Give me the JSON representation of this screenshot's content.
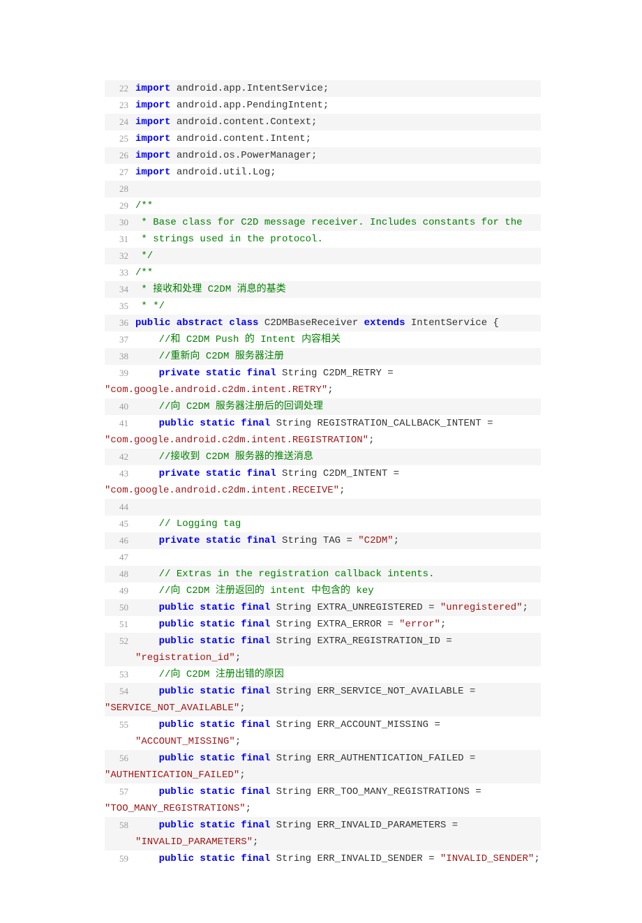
{
  "code_lines": [
    {
      "n": 22,
      "bg": true,
      "tokens": [
        {
          "t": "import",
          "c": "kw"
        },
        {
          "t": " android.app.IntentService;",
          "c": "plain"
        }
      ]
    },
    {
      "n": 23,
      "bg": false,
      "tokens": [
        {
          "t": "import",
          "c": "kw"
        },
        {
          "t": " android.app.PendingIntent;",
          "c": "plain"
        }
      ]
    },
    {
      "n": 24,
      "bg": true,
      "tokens": [
        {
          "t": "import",
          "c": "kw"
        },
        {
          "t": " android.content.Context;",
          "c": "plain"
        }
      ]
    },
    {
      "n": 25,
      "bg": false,
      "tokens": [
        {
          "t": "import",
          "c": "kw"
        },
        {
          "t": " android.content.Intent;",
          "c": "plain"
        }
      ]
    },
    {
      "n": 26,
      "bg": true,
      "tokens": [
        {
          "t": "import",
          "c": "kw"
        },
        {
          "t": " android.os.PowerManager;",
          "c": "plain"
        }
      ]
    },
    {
      "n": 27,
      "bg": false,
      "tokens": [
        {
          "t": "import",
          "c": "kw"
        },
        {
          "t": " android.util.Log;",
          "c": "plain"
        }
      ]
    },
    {
      "n": 28,
      "bg": true,
      "tokens": []
    },
    {
      "n": 29,
      "bg": false,
      "tokens": [
        {
          "t": "/**",
          "c": "cmt"
        }
      ]
    },
    {
      "n": 30,
      "bg": true,
      "tokens": [
        {
          "t": " * Base class for C2D message receiver. Includes constants for the",
          "c": "cmt"
        }
      ]
    },
    {
      "n": 31,
      "bg": false,
      "tokens": [
        {
          "t": " * strings used in the protocol.",
          "c": "cmt"
        }
      ]
    },
    {
      "n": 32,
      "bg": true,
      "tokens": [
        {
          "t": " */",
          "c": "cmt"
        }
      ]
    },
    {
      "n": 33,
      "bg": false,
      "tokens": [
        {
          "t": "/**",
          "c": "cmt"
        }
      ]
    },
    {
      "n": 34,
      "bg": true,
      "tokens": [
        {
          "t": " * ",
          "c": "cmt"
        },
        {
          "t": "接收和处理",
          "c": "cmtcn"
        },
        {
          "t": " C2DM ",
          "c": "cmt"
        },
        {
          "t": "消息的基类",
          "c": "cmtcn"
        }
      ]
    },
    {
      "n": 35,
      "bg": false,
      "tokens": [
        {
          "t": " * */",
          "c": "cmt"
        }
      ]
    },
    {
      "n": 36,
      "bg": true,
      "tokens": [
        {
          "t": "public abstract class",
          "c": "kw"
        },
        {
          "t": " C2DMBaseReceiver ",
          "c": "plain"
        },
        {
          "t": "extends",
          "c": "kw"
        },
        {
          "t": " IntentService {",
          "c": "plain"
        }
      ]
    },
    {
      "n": 37,
      "bg": false,
      "tokens": [
        {
          "t": "    ",
          "c": "plain"
        },
        {
          "t": "//",
          "c": "cmt"
        },
        {
          "t": "和",
          "c": "cmtcn"
        },
        {
          "t": " C2DM Push ",
          "c": "cmt"
        },
        {
          "t": "的",
          "c": "cmtcn"
        },
        {
          "t": " Intent ",
          "c": "cmt"
        },
        {
          "t": "内容相关",
          "c": "cmtcn"
        }
      ]
    },
    {
      "n": 38,
      "bg": true,
      "tokens": [
        {
          "t": "    ",
          "c": "plain"
        },
        {
          "t": "//",
          "c": "cmt"
        },
        {
          "t": "重新向",
          "c": "cmtcn"
        },
        {
          "t": " C2DM ",
          "c": "cmt"
        },
        {
          "t": "服务器注册",
          "c": "cmtcn"
        }
      ]
    },
    {
      "n": 39,
      "bg": false,
      "tokens": [
        {
          "t": "    ",
          "c": "plain"
        },
        {
          "t": "private static final",
          "c": "kw"
        },
        {
          "t": " String C2DM_RETRY = ",
          "c": "plain"
        }
      ],
      "wrap": [
        {
          "t": "\"com.google.android.c2dm.intent.RETRY\"",
          "c": "str"
        },
        {
          "t": ";",
          "c": "plain"
        }
      ]
    },
    {
      "n": 40,
      "bg": true,
      "tokens": [
        {
          "t": "    ",
          "c": "plain"
        },
        {
          "t": "//",
          "c": "cmt"
        },
        {
          "t": "向",
          "c": "cmtcn"
        },
        {
          "t": " C2DM ",
          "c": "cmt"
        },
        {
          "t": "服务器注册后的回调处理",
          "c": "cmtcn"
        }
      ]
    },
    {
      "n": 41,
      "bg": false,
      "tokens": [
        {
          "t": "    ",
          "c": "plain"
        },
        {
          "t": "public static final",
          "c": "kw"
        },
        {
          "t": " String REGISTRATION_CALLBACK_INTENT = ",
          "c": "plain"
        }
      ],
      "wrap": [
        {
          "t": "\"com.google.android.c2dm.intent.REGISTRATION\"",
          "c": "str"
        },
        {
          "t": ";",
          "c": "plain"
        }
      ]
    },
    {
      "n": 42,
      "bg": true,
      "tokens": [
        {
          "t": "    ",
          "c": "plain"
        },
        {
          "t": "//",
          "c": "cmt"
        },
        {
          "t": "接收到",
          "c": "cmtcn"
        },
        {
          "t": " C2DM ",
          "c": "cmt"
        },
        {
          "t": "服务器的推送消息",
          "c": "cmtcn"
        }
      ]
    },
    {
      "n": 43,
      "bg": false,
      "tokens": [
        {
          "t": "    ",
          "c": "plain"
        },
        {
          "t": "private static final",
          "c": "kw"
        },
        {
          "t": " String C2DM_INTENT = ",
          "c": "plain"
        }
      ],
      "wrap": [
        {
          "t": "\"com.google.android.c2dm.intent.RECEIVE\"",
          "c": "str"
        },
        {
          "t": ";",
          "c": "plain"
        }
      ]
    },
    {
      "n": 44,
      "bg": true,
      "tokens": []
    },
    {
      "n": 45,
      "bg": false,
      "tokens": [
        {
          "t": "    ",
          "c": "plain"
        },
        {
          "t": "// Logging tag",
          "c": "cmt"
        }
      ]
    },
    {
      "n": 46,
      "bg": true,
      "tokens": [
        {
          "t": "    ",
          "c": "plain"
        },
        {
          "t": "private static final",
          "c": "kw"
        },
        {
          "t": " String TAG = ",
          "c": "plain"
        },
        {
          "t": "\"C2DM\"",
          "c": "str"
        },
        {
          "t": ";",
          "c": "plain"
        }
      ]
    },
    {
      "n": 47,
      "bg": false,
      "tokens": []
    },
    {
      "n": 48,
      "bg": true,
      "tokens": [
        {
          "t": "    ",
          "c": "plain"
        },
        {
          "t": "// Extras in the registration callback intents.",
          "c": "cmt"
        }
      ]
    },
    {
      "n": 49,
      "bg": false,
      "tokens": [
        {
          "t": "    ",
          "c": "plain"
        },
        {
          "t": "//",
          "c": "cmt"
        },
        {
          "t": "向",
          "c": "cmtcn"
        },
        {
          "t": " C2DM ",
          "c": "cmt"
        },
        {
          "t": "注册返回的",
          "c": "cmtcn"
        },
        {
          "t": " intent ",
          "c": "cmt"
        },
        {
          "t": "中包含的",
          "c": "cmtcn"
        },
        {
          "t": " key",
          "c": "cmt"
        }
      ]
    },
    {
      "n": 50,
      "bg": true,
      "tokens": [
        {
          "t": "    ",
          "c": "plain"
        },
        {
          "t": "public static final",
          "c": "kw"
        },
        {
          "t": " String EXTRA_UNREGISTERED = ",
          "c": "plain"
        },
        {
          "t": "\"unregistered\"",
          "c": "str"
        },
        {
          "t": ";",
          "c": "plain"
        }
      ]
    },
    {
      "n": 51,
      "bg": false,
      "tokens": [
        {
          "t": "    ",
          "c": "plain"
        },
        {
          "t": "public static final",
          "c": "kw"
        },
        {
          "t": " String EXTRA_ERROR = ",
          "c": "plain"
        },
        {
          "t": "\"error\"",
          "c": "str"
        },
        {
          "t": ";",
          "c": "plain"
        }
      ]
    },
    {
      "n": 52,
      "bg": true,
      "tokens": [
        {
          "t": "    ",
          "c": "plain"
        },
        {
          "t": "public static final",
          "c": "kw"
        },
        {
          "t": " String EXTRA_REGISTRATION_ID = ",
          "c": "plain"
        },
        {
          "t": "\"registration_id\"",
          "c": "str"
        },
        {
          "t": ";",
          "c": "plain"
        }
      ]
    },
    {
      "n": 53,
      "bg": false,
      "tokens": [
        {
          "t": "    ",
          "c": "plain"
        },
        {
          "t": "//",
          "c": "cmt"
        },
        {
          "t": "向",
          "c": "cmtcn"
        },
        {
          "t": " C2DM ",
          "c": "cmt"
        },
        {
          "t": "注册出错的原因",
          "c": "cmtcn"
        }
      ]
    },
    {
      "n": 54,
      "bg": true,
      "tokens": [
        {
          "t": "    ",
          "c": "plain"
        },
        {
          "t": "public static final",
          "c": "kw"
        },
        {
          "t": " String ERR_SERVICE_NOT_AVAILABLE = ",
          "c": "plain"
        }
      ],
      "wrap": [
        {
          "t": "\"SERVICE_NOT_AVAILABLE\"",
          "c": "str"
        },
        {
          "t": ";",
          "c": "plain"
        }
      ]
    },
    {
      "n": 55,
      "bg": false,
      "tokens": [
        {
          "t": "    ",
          "c": "plain"
        },
        {
          "t": "public static final",
          "c": "kw"
        },
        {
          "t": " String ERR_ACCOUNT_MISSING = ",
          "c": "plain"
        },
        {
          "t": "\"ACCOUNT_MISSING\"",
          "c": "str"
        },
        {
          "t": ";",
          "c": "plain"
        }
      ]
    },
    {
      "n": 56,
      "bg": true,
      "tokens": [
        {
          "t": "    ",
          "c": "plain"
        },
        {
          "t": "public static final",
          "c": "kw"
        },
        {
          "t": " String ERR_AUTHENTICATION_FAILED = ",
          "c": "plain"
        }
      ],
      "wrap": [
        {
          "t": "\"AUTHENTICATION_FAILED\"",
          "c": "str"
        },
        {
          "t": ";",
          "c": "plain"
        }
      ]
    },
    {
      "n": 57,
      "bg": false,
      "tokens": [
        {
          "t": "    ",
          "c": "plain"
        },
        {
          "t": "public static final",
          "c": "kw"
        },
        {
          "t": " String ERR_TOO_MANY_REGISTRATIONS = ",
          "c": "plain"
        }
      ],
      "wrap": [
        {
          "t": "\"TOO_MANY_REGISTRATIONS\"",
          "c": "str"
        },
        {
          "t": ";",
          "c": "plain"
        }
      ]
    },
    {
      "n": 58,
      "bg": true,
      "tokens": [
        {
          "t": "    ",
          "c": "plain"
        },
        {
          "t": "public static final",
          "c": "kw"
        },
        {
          "t": " String ERR_INVALID_PARAMETERS = ",
          "c": "plain"
        },
        {
          "t": "\"INVALID_PARAMETERS\"",
          "c": "str"
        },
        {
          "t": ";",
          "c": "plain"
        }
      ]
    },
    {
      "n": 59,
      "bg": false,
      "tokens": [
        {
          "t": "    ",
          "c": "plain"
        },
        {
          "t": "public static final",
          "c": "kw"
        },
        {
          "t": " String ERR_INVALID_SENDER = ",
          "c": "plain"
        },
        {
          "t": "\"INVALID_SENDER\"",
          "c": "str"
        },
        {
          "t": ";",
          "c": "plain"
        }
      ]
    }
  ]
}
